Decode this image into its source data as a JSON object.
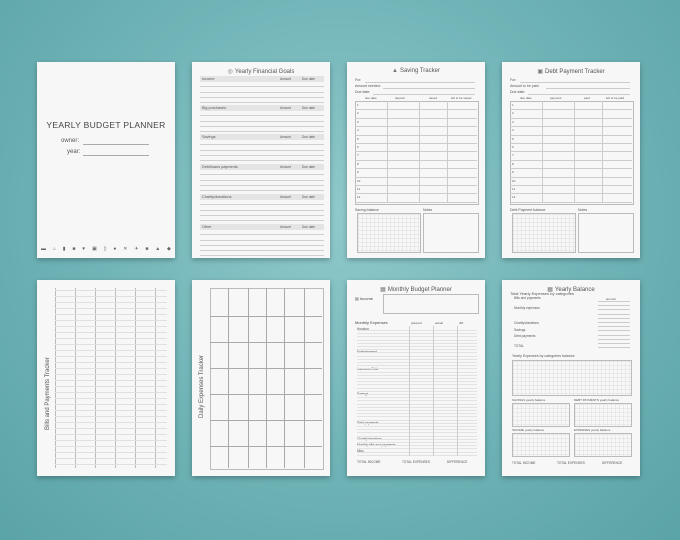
{
  "cover": {
    "title": "YEARLY BUDGET PLANNER",
    "owner_label": "owner:",
    "year_label": "year:",
    "icons": [
      "car-icon",
      "home-icon",
      "chart-icon",
      "bag-icon",
      "heart-icon",
      "gift-icon",
      "phone-icon",
      "food-icon",
      "tools-icon",
      "plane-icon",
      "bus-icon",
      "cart-icon",
      "coin-icon"
    ]
  },
  "goals": {
    "title": "Yearly Financial Goals",
    "sections": [
      "Income",
      "Big purchases",
      "Savings",
      "Debt/loans payments",
      "Charity/donations",
      "Other"
    ],
    "amount_label": "Amount",
    "due_date_label": "Due date"
  },
  "saving": {
    "title": "Saving Tracker",
    "for_label": "For:",
    "amount_label": "Amount needed:",
    "due_label": "Due date:",
    "columns": [
      "due date",
      "deposit",
      "saved",
      "left to be saved"
    ],
    "balance_label": "Saving balance",
    "notes_label": "Notes"
  },
  "debt": {
    "title": "Debt Payment Tracker",
    "for_label": "For:",
    "amount_label": "Amount to be paid:",
    "due_label": "Due date:",
    "columns": [
      "due date",
      "payment",
      "paid",
      "left to be paid"
    ],
    "balance_label": "Debt Payment balance",
    "notes_label": "Notes"
  },
  "bills": {
    "title": "Bills and Payments Tracker"
  },
  "daily": {
    "title": "Daily Expenses Tracker"
  },
  "monthly": {
    "title": "Monthly Budget Planner",
    "income_label": "Income",
    "expenses_label": "Monthly Expenses",
    "columns": [
      "planned",
      "actual",
      "diff."
    ],
    "groups": [
      "Housing",
      "Entertainment",
      "Insurance/Tolls",
      "Savings",
      "Debt payments",
      "Charity/donations",
      "Monthly bills and payments",
      "Misc."
    ],
    "total_income": "TOTAL INCOME",
    "total_expenses": "TOTAL EXPENSES",
    "difference": "DIFFERENCE"
  },
  "yearly": {
    "title": "Yearly Balance",
    "subtitle": "Total Yearly Expenses by categories",
    "amount_label": "amount",
    "categories": [
      "Bills and payments",
      "Monthly expenses",
      "Charity/donations",
      "Savings",
      "Debt payments",
      "TOTAL"
    ],
    "chart_label": "Yearly Expenses by categories balance",
    "savings_label": "SAVINGS",
    "debt_label": "DEBT PAYMENTS",
    "income_label": "INCOME",
    "expenses_label": "EXPENSES",
    "balance_suffix": "yearly balance",
    "total_income": "TOTAL INCOME",
    "total_expenses": "TOTAL EXPENSES",
    "difference": "DIFFERENCE"
  }
}
